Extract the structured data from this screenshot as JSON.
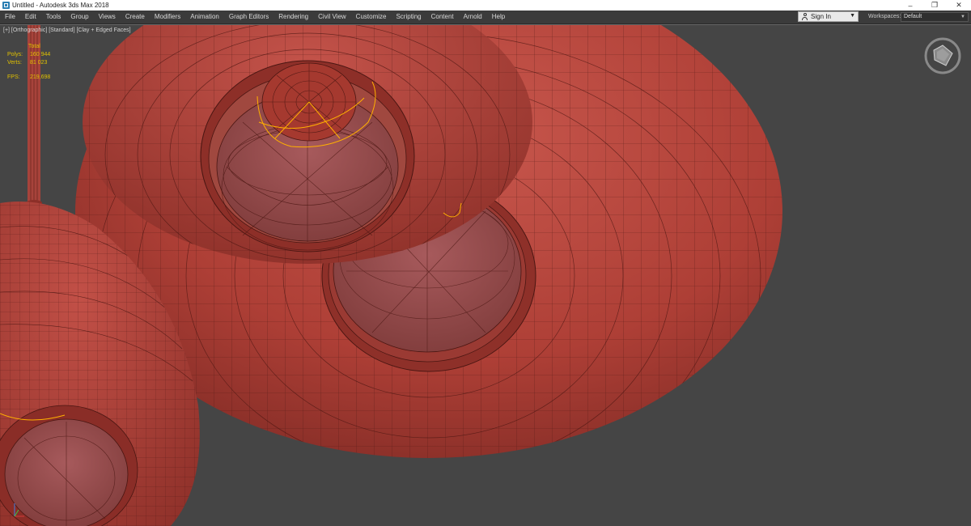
{
  "window": {
    "title": "Untitled - Autodesk 3ds Max 2018",
    "minimize": "–",
    "restore": "❐",
    "close": "✕"
  },
  "menu": {
    "items": [
      "File",
      "Edit",
      "Tools",
      "Group",
      "Views",
      "Create",
      "Modifiers",
      "Animation",
      "Graph Editors",
      "Rendering",
      "Civil View",
      "Customize",
      "Scripting",
      "Content",
      "Arnold",
      "Help"
    ]
  },
  "signin": {
    "label": "Sign In"
  },
  "workspaces": {
    "label": "Workspaces:",
    "value": "Default"
  },
  "viewport": {
    "label": "[+] [Orthographic] [Standard] [Clay + Edged Faces]",
    "stats": {
      "total_label": "Total",
      "polys_label": "Polys:",
      "polys_value": "160 944",
      "verts_label": "Verts:",
      "verts_value": "81 023",
      "fps_label": "FPS:",
      "fps_value": "219,698"
    }
  },
  "colors": {
    "clay": "#b5473f",
    "wire": "#4a1612",
    "selection": "#ffb000",
    "viewport_bg": "#454545"
  },
  "icons": [
    "app-icon",
    "user-icon",
    "chevron-down-icon",
    "viewcube-icon",
    "axis-tripod-icon"
  ]
}
